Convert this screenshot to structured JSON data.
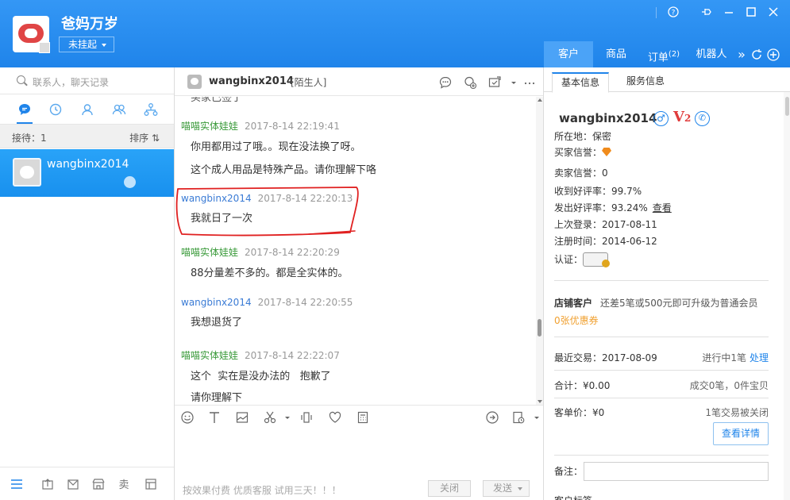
{
  "header": {
    "shop_name": "爸妈万岁",
    "status": "未挂起",
    "tabs": [
      {
        "label": "客户",
        "active": true
      },
      {
        "label": "商品"
      },
      {
        "label": "订单",
        "badge": "(2)"
      },
      {
        "label": "机器人"
      }
    ],
    "more": "»"
  },
  "left": {
    "search_placeholder": "联系人，聊天记录",
    "waiting_label": "接待：1",
    "sort_label": "排序 ⇅",
    "contacts": [
      {
        "name": "wangbinx2014",
        "selected": true
      }
    ]
  },
  "chat": {
    "title": "wangbinx2014",
    "tag": "[陌生人]",
    "top_cut_text": "买家已签了",
    "messages": [
      {
        "sender": "喵喵实体娃娃",
        "role": "shop",
        "time": "2017-8-14 22:19:41",
        "lines": [
          "你用都用过了哦。。现在没法换了呀。",
          "这个成人用品是特殊产品。请你理解下咯"
        ]
      },
      {
        "sender": "wangbinx2014",
        "role": "cust",
        "time": "2017-8-14 22:20:13",
        "lines": [
          "我就日了一次"
        ]
      },
      {
        "sender": "喵喵实体娃娃",
        "role": "shop",
        "time": "2017-8-14 22:20:29",
        "lines": [
          "88分量差不多的。都是全实体的。"
        ]
      },
      {
        "sender": "wangbinx2014",
        "role": "cust",
        "time": "2017-8-14 22:20:55",
        "lines": [
          "我想退货了"
        ]
      },
      {
        "sender": "喵喵实体娃娃",
        "role": "shop",
        "time": "2017-8-14 22:22:07",
        "lines": [
          "这个  实在是没办法的   抱歉了",
          "请你理解下"
        ]
      }
    ],
    "ad_text": "按效果付费 优质客服 试用三天！！！",
    "close_label": "关闭",
    "send_label": "发送"
  },
  "right": {
    "tabs": [
      {
        "label": "基本信息",
        "active": true
      },
      {
        "label": "服务信息"
      }
    ],
    "customer_name": "wangbinx2014",
    "vip_label": "V",
    "vip_level": "2",
    "location": "所在地：保密",
    "buyer_credit": "买家信誉：",
    "seller_credit": "卖家信誉：0",
    "good_received": "收到好评率：99.7%",
    "good_given": "发出好评率：93.24%",
    "view_link": "查看",
    "last_login": "上次登录：2017-08-11",
    "register_time": "注册时间：2014-06-12",
    "certification": "认证：",
    "shop_customer_title": "店铺客户",
    "shop_customer_desc": "还差5笔或500元即可升级为普通会员",
    "coupon": "0张优惠券",
    "recent_trade": "最近交易：2017-08-09",
    "in_progress": "进行中1笔",
    "handle_link": "处理",
    "total": "合计：¥0.00",
    "deal_summary": "成交0笔，0件宝贝",
    "avg_price": "客单价：¥0",
    "closed_summary": "1笔交易被关闭",
    "detail_button": "查看详情",
    "note_label": "备注：",
    "tags_label": "客户标签"
  },
  "colors": {
    "accent": "#1f84ea",
    "shop_sender": "#3a9a3a",
    "cust_sender": "#3a7bd5",
    "vip": "#e03c3c",
    "coupon": "#f0a030"
  }
}
